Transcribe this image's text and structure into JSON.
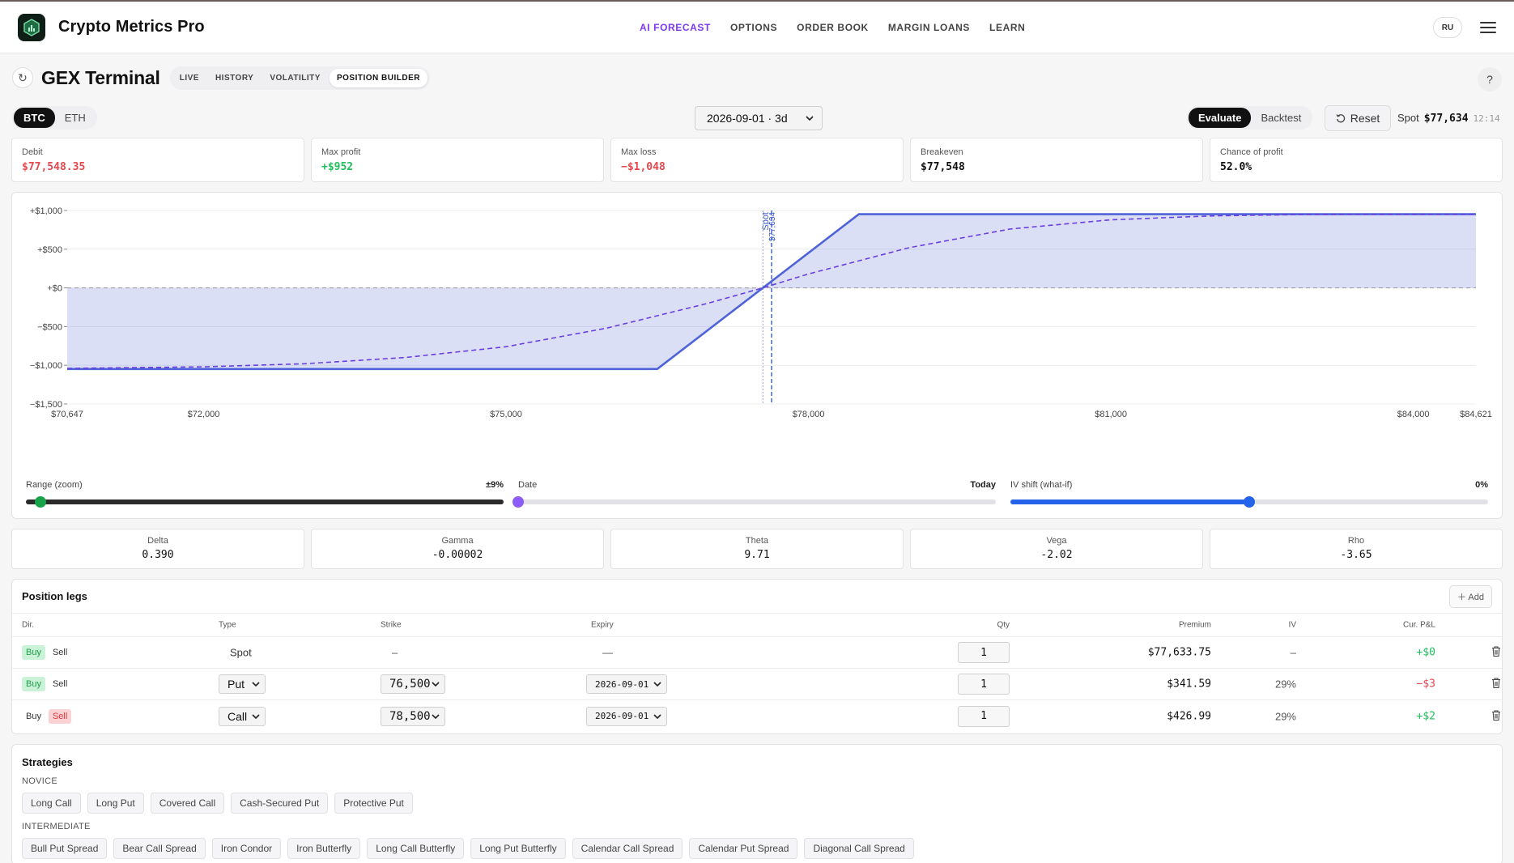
{
  "app": {
    "brand": "Crypto Metrics Pro"
  },
  "nav": {
    "links": [
      "AI FORECAST",
      "OPTIONS",
      "ORDER BOOK",
      "MARGIN LOANS",
      "LEARN"
    ],
    "lang": "RU"
  },
  "page": {
    "title": "GEX Terminal",
    "tabs": [
      "LIVE",
      "HISTORY",
      "VOLATILITY",
      "POSITION BUILDER"
    ],
    "active_tab": "POSITION BUILDER",
    "help": "?"
  },
  "controls": {
    "assets": [
      "BTC",
      "ETH"
    ],
    "active_asset": "BTC",
    "expiry_select": "2026-09-01 · 3d",
    "modes": [
      "Evaluate",
      "Backtest"
    ],
    "active_mode": "Evaluate",
    "reset_label": "Reset",
    "spot_label": "Spot",
    "spot_value": "$77,634",
    "spot_time": "12:14"
  },
  "metrics": [
    {
      "label": "Debit",
      "value": "$77,548.35",
      "tone": "neg"
    },
    {
      "label": "Max profit",
      "value": "+$952",
      "tone": "pos"
    },
    {
      "label": "Max loss",
      "value": "−$1,048",
      "tone": "neg"
    },
    {
      "label": "Breakeven",
      "value": "$77,548",
      "tone": "plain"
    },
    {
      "label": "Chance of profit",
      "value": "52.0%",
      "tone": "plain"
    }
  ],
  "chart_data": {
    "type": "line",
    "title": "",
    "xlabel": "",
    "ylabel": "",
    "xlim": [
      70647,
      84621
    ],
    "ylim": [
      -1500,
      1000
    ],
    "x_ticks": [
      "$70,647",
      "$72,000",
      "$75,000",
      "$78,000",
      "$81,000",
      "$84,000",
      "$84,621"
    ],
    "x_tick_values": [
      70647,
      72000,
      75000,
      78000,
      81000,
      84000,
      84621
    ],
    "y_ticks": [
      "+$1,000",
      "+$500",
      "+$0",
      "−$500",
      "−$1,000",
      "−$1,500"
    ],
    "y_tick_values": [
      1000,
      500,
      0,
      -500,
      -1000,
      -1500
    ],
    "spot_label": "Spot",
    "spot_value_label": "$77,634",
    "spot": 77634,
    "breakeven": 77548,
    "series": [
      {
        "style": "solid",
        "color": "#4f63d9",
        "x": [
          70647,
          76500,
          78500,
          84621
        ],
        "y": [
          -1048,
          -1048,
          952,
          952
        ]
      },
      {
        "style": "dashed",
        "color": "#6a3fe0",
        "x": [
          70647,
          72000,
          73000,
          74000,
          75000,
          76000,
          77000,
          77548,
          78000,
          79000,
          80000,
          81000,
          82000,
          83000,
          84621
        ],
        "y": [
          -1040,
          -1020,
          -980,
          -900,
          -760,
          -520,
          -200,
          0,
          180,
          520,
          760,
          880,
          930,
          950,
          952
        ]
      }
    ],
    "grid": true
  },
  "sliders": [
    {
      "label": "Range (zoom)",
      "value": "±9%",
      "fraction": 0.03,
      "color": "#111"
    },
    {
      "label": "Date",
      "value": "Today",
      "fraction": 0.0,
      "color": "#8b5cf6"
    },
    {
      "label": "IV shift (what-if)",
      "value": "0%",
      "fraction": 0.5,
      "color": "#2563eb"
    }
  ],
  "greeks": [
    {
      "label": "Delta",
      "value": "0.390"
    },
    {
      "label": "Gamma",
      "value": "-0.00002"
    },
    {
      "label": "Theta",
      "value": "9.71"
    },
    {
      "label": "Vega",
      "value": "-2.02"
    },
    {
      "label": "Rho",
      "value": "-3.65"
    }
  ],
  "legs": {
    "title": "Position legs",
    "add_label": "Add",
    "columns": [
      "Dir.",
      "Type",
      "Strike",
      "Expiry",
      "Qty",
      "Premium",
      "IV",
      "Cur. P&L"
    ],
    "buy_label": "Buy",
    "sell_label": "Sell",
    "rows": [
      {
        "dir": "buy",
        "type": "Spot",
        "strike": "–",
        "expiry": "—",
        "qty": "1",
        "premium": "$77,633.75",
        "iv": "–",
        "pnl": "+$0",
        "tone": "pos",
        "select": false
      },
      {
        "dir": "buy",
        "type": "Put",
        "strike": "76,500",
        "expiry": "2026-09-01",
        "qty": "1",
        "premium": "$341.59",
        "iv": "29%",
        "pnl": "−$3",
        "tone": "neg",
        "select": true
      },
      {
        "dir": "sell",
        "type": "Call",
        "strike": "78,500",
        "expiry": "2026-09-01",
        "qty": "1",
        "premium": "$426.99",
        "iv": "29%",
        "pnl": "+$2",
        "tone": "pos",
        "select": true
      }
    ]
  },
  "strategies": {
    "title": "Strategies",
    "groups": [
      {
        "name": "NOVICE",
        "items": [
          "Long Call",
          "Long Put",
          "Covered Call",
          "Cash-Secured Put",
          "Protective Put"
        ]
      },
      {
        "name": "INTERMEDIATE",
        "items": [
          "Bull Put Spread",
          "Bear Call Spread",
          "Iron Condor",
          "Iron Butterfly",
          "Long Call Butterfly",
          "Long Put Butterfly",
          "Calendar Call Spread",
          "Calendar Put Spread",
          "Diagonal Call Spread"
        ]
      }
    ]
  }
}
